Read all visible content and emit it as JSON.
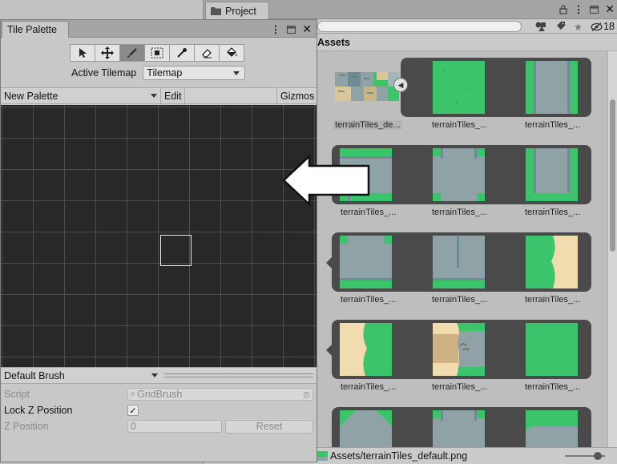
{
  "project": {
    "tab_title": "Project",
    "breadcrumb": "Assets",
    "hidden_count": "18",
    "status_path": "Assets/terrainTiles_default.png",
    "assets": [
      {
        "label": "terrainTiles_de...",
        "selected": true
      },
      {
        "label": "terrainTiles_..."
      },
      {
        "label": "terrainTiles_..."
      },
      {
        "label": "terrainTiles_..."
      },
      {
        "label": "terrainTiles_..."
      },
      {
        "label": "terrainTiles_..."
      },
      {
        "label": "terrainTiles_..."
      },
      {
        "label": "terrainTiles_..."
      },
      {
        "label": "terrainTiles_..."
      },
      {
        "label": "terrainTiles_..."
      },
      {
        "label": "terrainTiles_..."
      },
      {
        "label": "terrainTiles_..."
      }
    ]
  },
  "palette": {
    "tab_title": "Tile Palette",
    "tools": [
      "select-tool",
      "move-tool",
      "paint-brush-tool",
      "box-fill-tool",
      "picker-tool",
      "eraser-tool",
      "flood-fill-tool"
    ],
    "active_tool_index": 2,
    "active_tilemap_label": "Active Tilemap",
    "active_tilemap_value": "Tilemap",
    "palette_select": "New Palette",
    "edit_label": "Edit",
    "gizmos_label": "Gizmos",
    "brush_select": "Default Brush",
    "props": {
      "script_label": "Script",
      "script_value": "GridBrush",
      "lockz_label": "Lock Z Position",
      "lockz_checked": "✓",
      "zpos_label": "Z Position",
      "zpos_value": "0",
      "reset_label": "Reset"
    }
  },
  "colors": {
    "grass": "#3cc46a",
    "road": "#8fa3a6",
    "sand": "#f0dcae",
    "palette_bg": "#282828"
  }
}
